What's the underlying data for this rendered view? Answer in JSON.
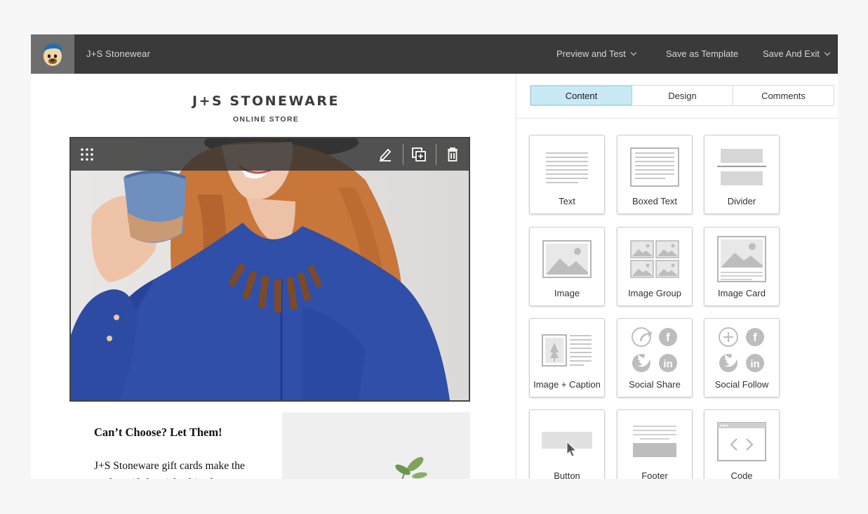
{
  "topbar": {
    "campaign_name": "J+S Stonewear",
    "preview_label": "Preview and Test",
    "save_template_label": "Save as Template",
    "save_exit_label": "Save And Exit"
  },
  "email": {
    "brand_title": "J+S STONEWARE",
    "brand_subtitle": "ONLINE STORE",
    "section_title": "Can’t Choose? Let Them!",
    "section_body": "J+S Stoneware gift cards make the perfect gift for picky friends, go..."
  },
  "panel": {
    "tabs": [
      {
        "label": "Content",
        "active": true
      },
      {
        "label": "Design",
        "active": false
      },
      {
        "label": "Comments",
        "active": false
      }
    ],
    "blocks": [
      {
        "label": "Text",
        "icon": "text-block-icon"
      },
      {
        "label": "Boxed Text",
        "icon": "boxed-text-block-icon"
      },
      {
        "label": "Divider",
        "icon": "divider-block-icon"
      },
      {
        "label": "Image",
        "icon": "image-block-icon"
      },
      {
        "label": "Image Group",
        "icon": "image-group-block-icon"
      },
      {
        "label": "Image Card",
        "icon": "image-card-block-icon"
      },
      {
        "label": "Image + Caption",
        "icon": "image-caption-block-icon"
      },
      {
        "label": "Social Share",
        "icon": "social-share-block-icon"
      },
      {
        "label": "Social Follow",
        "icon": "social-follow-block-icon"
      },
      {
        "label": "Button",
        "icon": "button-block-icon"
      },
      {
        "label": "Footer",
        "icon": "footer-block-icon"
      },
      {
        "label": "Code",
        "icon": "code-block-icon"
      }
    ]
  },
  "colors": {
    "topbar": "#3a3a3a",
    "active_tab": "#c9e9f4",
    "shirt": "#2f4fa8",
    "hair": "#c9763a"
  }
}
